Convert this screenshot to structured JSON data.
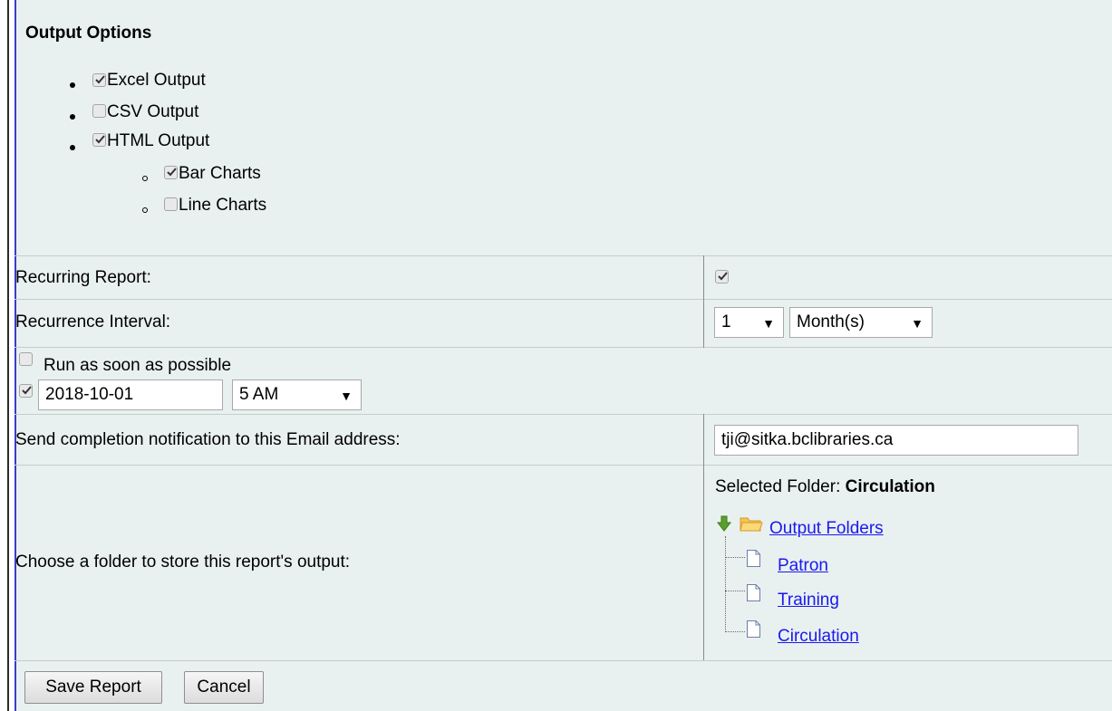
{
  "output_options": {
    "heading": "Output Options",
    "items": [
      {
        "label": "Excel Output",
        "checked": true
      },
      {
        "label": "CSV Output",
        "checked": false
      },
      {
        "label": "HTML Output",
        "checked": true
      }
    ],
    "sub_items": [
      {
        "label": "Bar Charts",
        "checked": true
      },
      {
        "label": "Line Charts",
        "checked": false
      }
    ]
  },
  "recurring": {
    "label": "Recurring Report:",
    "checked": true
  },
  "interval": {
    "label": "Recurrence Interval:",
    "count": "1",
    "unit": "Month(s)"
  },
  "schedule": {
    "asap_label": "Run as soon as possible",
    "asap_checked": false,
    "date_checked": true,
    "date": "2018-10-01",
    "time": "5 AM"
  },
  "email": {
    "label": "Send completion notification to this Email address:",
    "value": "tji@sitka.bclibraries.ca"
  },
  "folder": {
    "label": "Choose a folder to store this report's output:",
    "selected_prefix": "Selected Folder:",
    "selected_value": "Circulation",
    "root": "Output Folders",
    "children": [
      "Patron",
      "Training",
      "Circulation"
    ]
  },
  "buttons": {
    "save": "Save Report",
    "cancel": "Cancel"
  }
}
